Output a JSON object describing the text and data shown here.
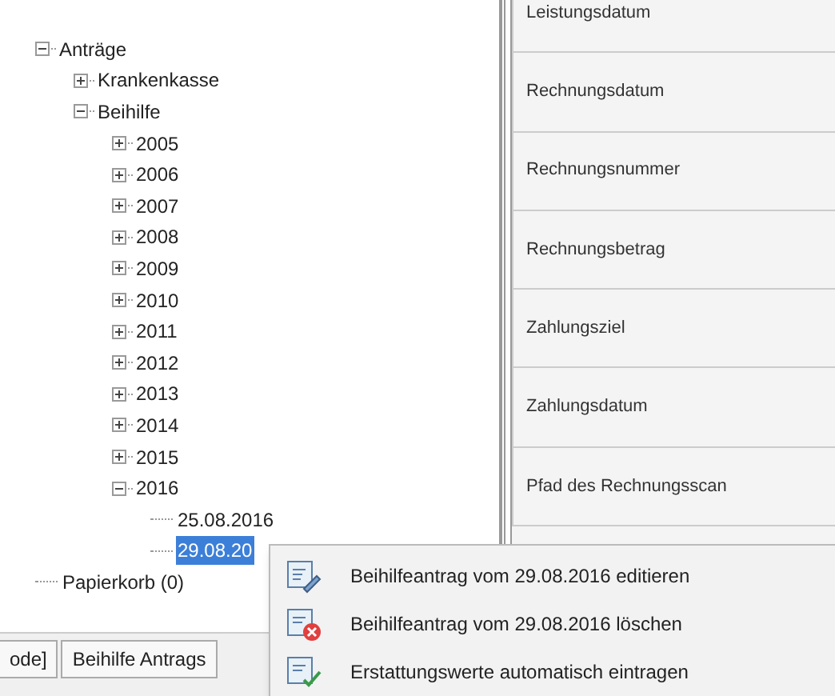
{
  "tree": [
    {
      "label": "Anträge",
      "expanded": true,
      "children": [
        {
          "label": "Krankenkasse",
          "expanded": false
        },
        {
          "label": "Beihilfe",
          "expanded": true,
          "children": [
            {
              "label": "2005",
              "expanded": false
            },
            {
              "label": "2006",
              "expanded": false
            },
            {
              "label": "2007",
              "expanded": false
            },
            {
              "label": "2008",
              "expanded": false
            },
            {
              "label": "2009",
              "expanded": false
            },
            {
              "label": "2010",
              "expanded": false
            },
            {
              "label": "2011",
              "expanded": false
            },
            {
              "label": "2012",
              "expanded": false
            },
            {
              "label": "2013",
              "expanded": false
            },
            {
              "label": "2014",
              "expanded": false
            },
            {
              "label": "2015",
              "expanded": false
            },
            {
              "label": "2016",
              "expanded": true,
              "children": [
                {
                  "label": "25.08.2016",
                  "selected": false
                },
                {
                  "label": "29.08.20",
                  "selected": true
                }
              ]
            }
          ]
        }
      ]
    },
    {
      "label": "Papierkorb (0)"
    }
  ],
  "form_fields": [
    "Leistungsdatum",
    "Rechnungsdatum",
    "Rechnungsnummer",
    "Rechnungsbetrag",
    "Zahlungsziel",
    "Zahlungsdatum",
    "Pfad des Rechnungsscan"
  ],
  "tabs": [
    {
      "label": "ode]"
    },
    {
      "label": "Beihilfe Antrags"
    }
  ],
  "context_menu": [
    {
      "kind": "edit",
      "label": "Beihilfeantrag vom 29.08.2016 editieren"
    },
    {
      "kind": "delete",
      "label": "Beihilfeantrag vom 29.08.2016 löschen"
    },
    {
      "kind": "auto",
      "label": "Erstattungswerte automatisch eintragen"
    }
  ]
}
